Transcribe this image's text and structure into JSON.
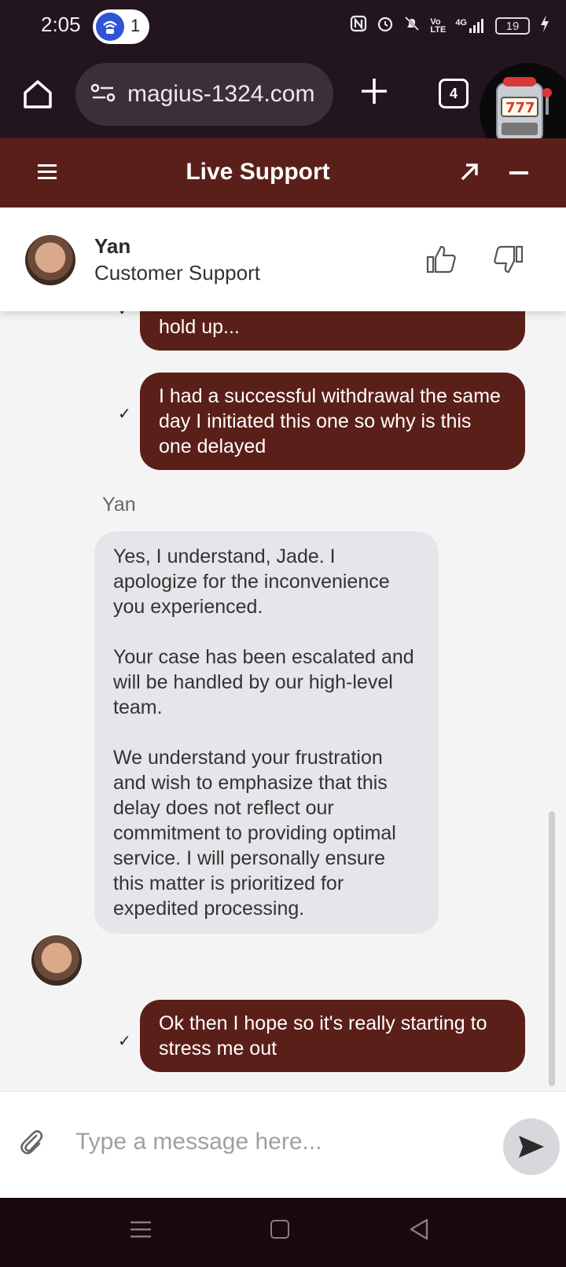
{
  "status_bar": {
    "time": "2:05",
    "hotspot_count": "1",
    "network": "4G",
    "battery": "19"
  },
  "browser": {
    "url": "magius-1324.com",
    "tab_count": "4"
  },
  "chat_header": {
    "title": "Live Support"
  },
  "agent": {
    "name": "Yan",
    "role": "Customer Support"
  },
  "messages": {
    "out_1": "weeks what is the issue what is the hold up...",
    "out_2": "I had a successful withdrawal the same day I initiated this one so why is this one delayed",
    "sender": "Yan",
    "in_1": "Yes, I understand, Jade. I apologize for the inconvenience you experienced.\n\nYour case has been escalated and will be handled by our high-level team.\n\nWe understand your frustration and wish to emphasize that this delay does not reflect our commitment to providing optimal service. I will personally ensure this matter is prioritized for expedited processing.",
    "out_3": "Ok then I hope so it's really starting to stress me out",
    "check_mark": "✓"
  },
  "composer": {
    "placeholder": "Type a message here..."
  },
  "colors": {
    "brand": "#5b1f19",
    "browser_bg": "#221520",
    "incoming_bubble": "#e4e6e9"
  }
}
